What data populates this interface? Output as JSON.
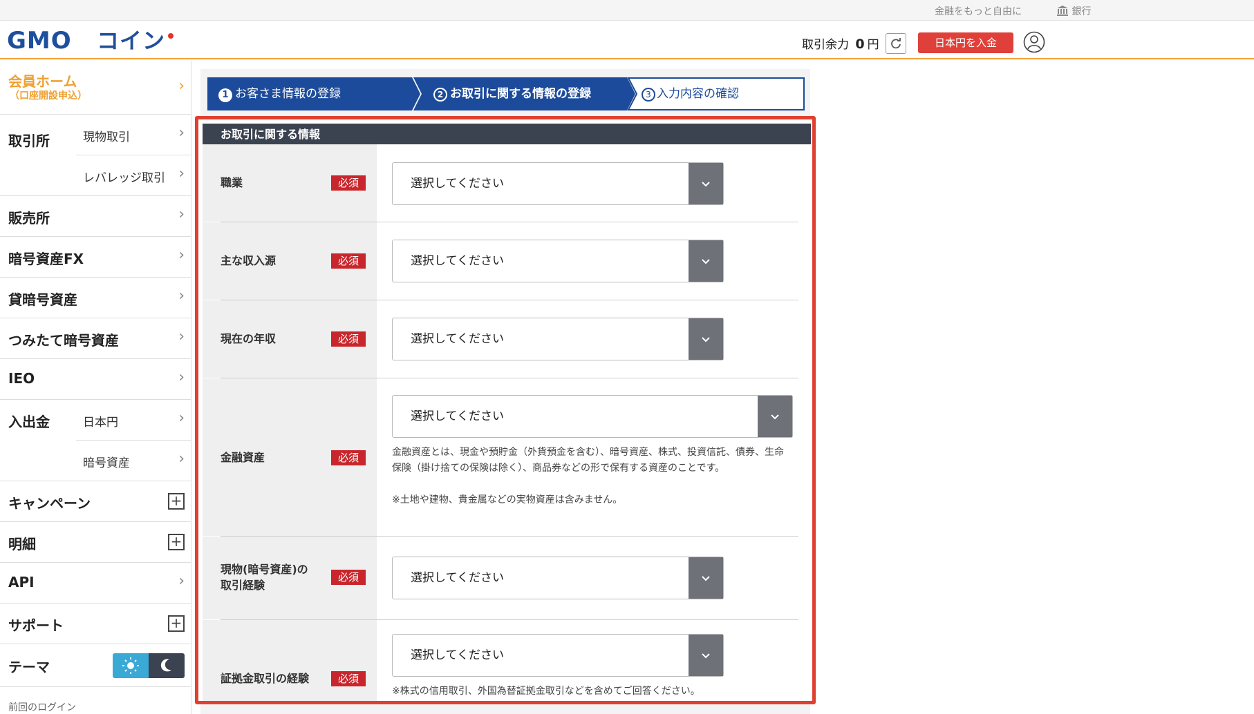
{
  "topbar": {
    "tagline": "金融をもっと自由に",
    "bank_label": "銀行"
  },
  "header": {
    "logo_text": "GMOコイン",
    "balance_label": "取引余力",
    "balance_value": "0",
    "balance_unit": "円",
    "deposit_button": "日本円を入金"
  },
  "sidebar": {
    "home_label": "会員ホーム",
    "home_sub": "（口座開設申込）",
    "exchange_label": "取引所",
    "exchange_spot": "現物取引",
    "exchange_leverage": "レバレッジ取引",
    "sales": "販売所",
    "fx": "暗号資産FX",
    "lending": "貸暗号資産",
    "tsumitate": "つみたて暗号資産",
    "ieo": "IEO",
    "inout_label": "入出金",
    "inout_jpy": "日本円",
    "inout_crypto": "暗号資産",
    "campaign": "キャンペーン",
    "statement": "明細",
    "api": "API",
    "support": "サポート",
    "theme": "テーマ",
    "last_login": "前回のログイン"
  },
  "steps": {
    "step1": "お客さま情報の登録",
    "step2": "お取引に関する情報の登録",
    "step3": "入力内容の確認"
  },
  "form": {
    "section_title": "お取引に関する情報",
    "required_badge": "必須",
    "rows": [
      {
        "label": "職業",
        "value": "選択してください"
      },
      {
        "label": "主な収入源",
        "value": "選択してください"
      },
      {
        "label": "現在の年収",
        "value": "選択してください"
      },
      {
        "label": "金融資産",
        "value": "選択してください"
      },
      {
        "label_line1": "現物(暗号資産)の",
        "label_line2": "取引経験",
        "value": "選択してください"
      },
      {
        "label": "証拠金取引の経験",
        "value": "選択してください"
      }
    ],
    "assets_note_1": "金融資産とは、現金や預貯金（外貨預金を含む）、暗号資産、株式、投資信託、債券、生命保険（掛け捨ての保険は除く）、商品券などの形で保有する資産のことです。",
    "assets_note_2": "※土地や建物、貴金属などの実物資産は含みません。",
    "margin_note": "※株式の信用取引、外国為替証拠金取引などを含めてご回答ください。"
  },
  "colors": {
    "accent_orange": "#f5a23a",
    "brand_blue": "#1e4f9c",
    "required_red": "#c8262c",
    "highlight_red": "#e0402f",
    "step_blue": "#1d4b9b",
    "section_dark": "#3b4250"
  },
  "icons": [
    "bank-icon",
    "refresh-icon",
    "user-icon",
    "chevron-right-icon",
    "plus-icon",
    "sun-icon",
    "moon-icon",
    "chevron-down-icon"
  ]
}
